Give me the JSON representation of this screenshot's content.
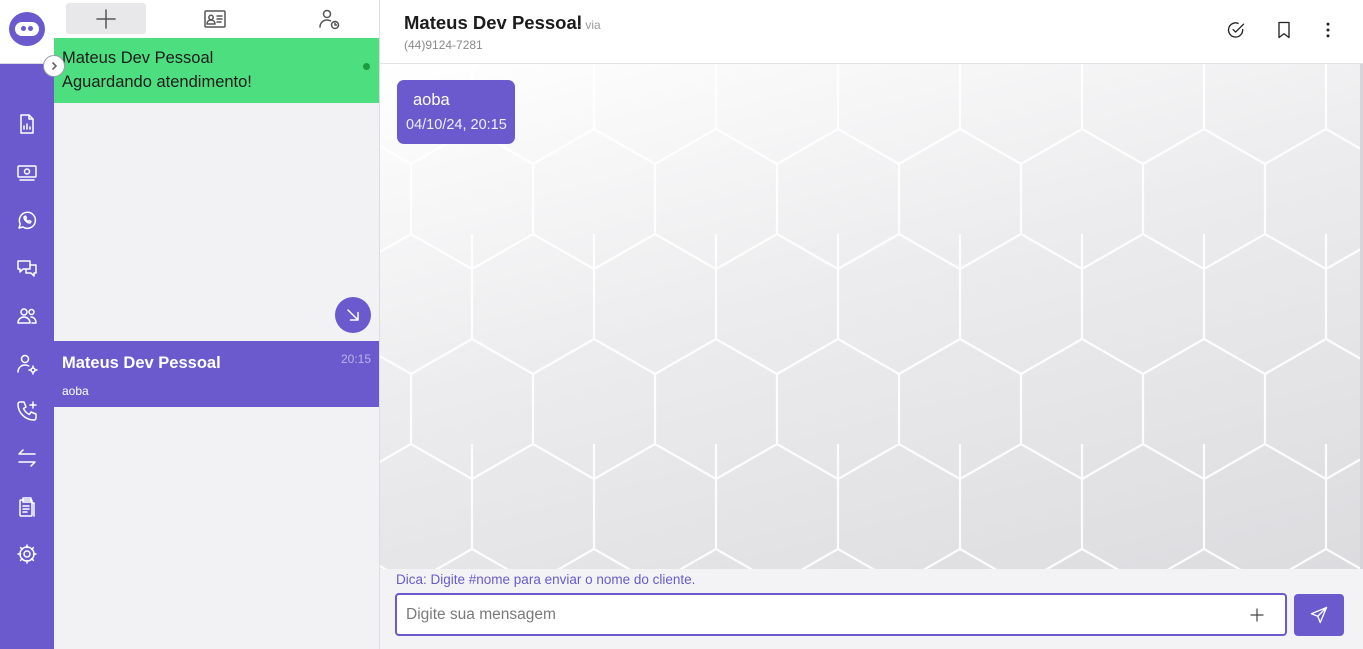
{
  "app": {
    "logo_icon": "robot-logo-icon"
  },
  "nav": {
    "items": [
      {
        "icon": "report-file-icon"
      },
      {
        "icon": "money-icon"
      },
      {
        "icon": "whatsapp-icon"
      },
      {
        "icon": "chat-bubbles-icon"
      },
      {
        "icon": "users-group-icon"
      },
      {
        "icon": "user-settings-icon"
      },
      {
        "icon": "phone-add-icon"
      },
      {
        "icon": "transfer-arrows-icon"
      },
      {
        "icon": "clipboard-list-icon"
      },
      {
        "icon": "gear-icon"
      }
    ]
  },
  "list": {
    "tabs": [
      {
        "icon": "plus-icon",
        "active": true
      },
      {
        "icon": "contact-card-icon",
        "active": false
      },
      {
        "icon": "user-clock-icon",
        "active": false
      }
    ],
    "pending": {
      "name": "Mateus Dev Pessoal",
      "status": "Aguardando atendimento!"
    },
    "tickets": [
      {
        "name": "Mateus Dev Pessoal",
        "time": "20:15",
        "preview": "aoba"
      }
    ]
  },
  "chat": {
    "title": "Mateus Dev Pessoal",
    "via": "- via",
    "phone": "(44)9124-7281",
    "messages": [
      {
        "text": "aoba",
        "time": "04/10/24, 20:15"
      }
    ],
    "hint": "Dica: Digite #nome para enviar o nome do cliente.",
    "input_placeholder": "Digite sua mensagem",
    "input_value": ""
  },
  "colors": {
    "primary": "#6a5acd",
    "pending_bg": "#4ddf7f",
    "panel_bg": "#f2f2f4"
  }
}
